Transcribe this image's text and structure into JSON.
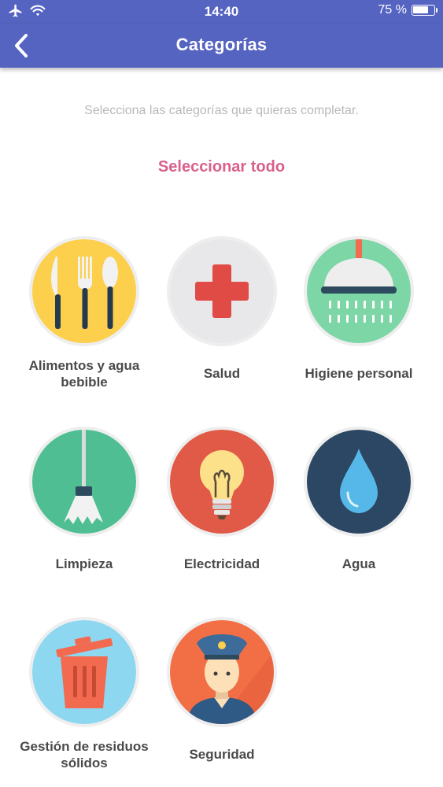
{
  "status_bar": {
    "time": "14:40",
    "battery": "75 %",
    "battery_level": 0.75
  },
  "header": {
    "title": "Categorías",
    "back_icon": "chevron-left-icon"
  },
  "main": {
    "subtitle": "Selecciona las categorías que quieras completar.",
    "select_all": "Seleccionar todo",
    "categories": [
      {
        "label": "Alimentos y agua bebible",
        "icon": "cutlery-icon",
        "color": "#fccf4d"
      },
      {
        "label": "Salud",
        "icon": "medical-cross-icon",
        "color": "#e8e8ea"
      },
      {
        "label": "Higiene personal",
        "icon": "shower-icon",
        "color": "#7dd6a5"
      },
      {
        "label": "Limpieza",
        "icon": "mop-icon",
        "color": "#4fbf93"
      },
      {
        "label": "Electricidad",
        "icon": "light-bulb-icon",
        "color": "#e05a47"
      },
      {
        "label": "Agua",
        "icon": "water-drop-icon",
        "color": "#2c4763"
      },
      {
        "label": "Gestión de residuos sólidos",
        "icon": "trash-bin-icon",
        "color": "#8ed7f0"
      },
      {
        "label": "Seguridad",
        "icon": "police-officer-icon",
        "color": "#f26f45"
      }
    ]
  }
}
